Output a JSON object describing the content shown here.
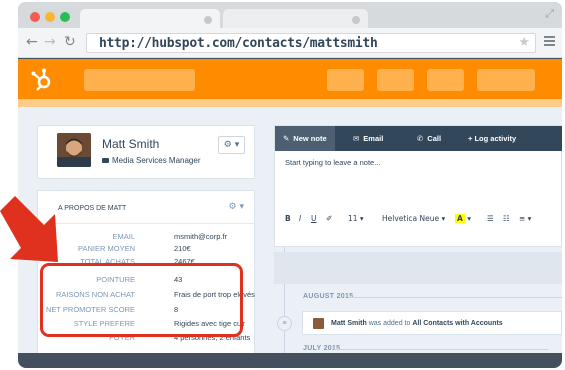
{
  "browser": {
    "url": "http://hubspot.com/contacts/mattsmith",
    "traffic_lights": [
      "#f25c54",
      "#f7b731",
      "#2bbd54"
    ]
  },
  "icons": {
    "back": "arrow-left-icon",
    "forward": "arrow-right-icon",
    "reload": "reload-icon",
    "star": "bookmark-star-icon",
    "menu": "hamburger-menu-icon"
  },
  "colors": {
    "hubspot_orange": "#ff8c00",
    "annotation_red": "#e0301e"
  },
  "contact": {
    "name": "Matt Smith",
    "job_title": "Media Services Manager"
  },
  "about": {
    "title": "A PROPOS DE MATT",
    "properties": [
      {
        "label": "EMAIL",
        "value": "msmith@corp.fr"
      },
      {
        "label": "PANIER MOYEN",
        "value": "210€"
      },
      {
        "label": "TOTAL ACHATS",
        "value": "2467€"
      },
      {
        "label": "POINTURE",
        "value": "43"
      },
      {
        "label": "RAISONS NON ACHAT",
        "value": "Frais de port trop elevés"
      },
      {
        "label": "NET PROMOTER SCORE",
        "value": "8"
      },
      {
        "label": "STYLE PREFERE",
        "value": "Rigides avec tige cuir"
      },
      {
        "label": "FOYER",
        "value": "4 personnes, 2 enfants"
      }
    ]
  },
  "composer": {
    "tabs": [
      "New note",
      "Email",
      "Call",
      "+ Log activity"
    ],
    "placeholder": "Start typing to leave a note...",
    "font_size": "11",
    "font_name": "Helvetica Neue"
  },
  "timeline": {
    "months": [
      "AUGUST 2015",
      "JULY 2015"
    ],
    "event": {
      "contact": "Matt Smith",
      "action": "was added to",
      "list": "All Contacts with Accounts"
    }
  }
}
